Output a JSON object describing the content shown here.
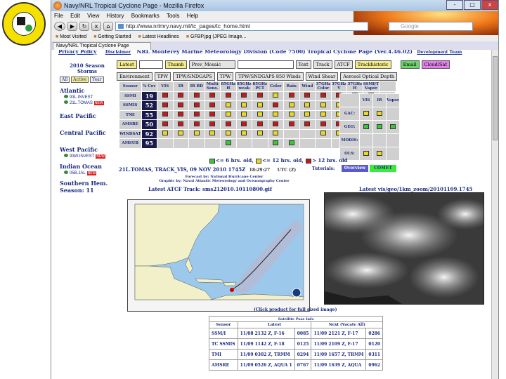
{
  "browser": {
    "window_title": "Navy/NRL Tropical Cyclone Page - Mozilla Firefox",
    "window_buttons": [
      "-",
      "□",
      "x"
    ],
    "menu": [
      "File",
      "Edit",
      "View",
      "History",
      "Bookmarks",
      "Tools",
      "Help"
    ],
    "nav_buttons": {
      "back": "◀",
      "forward": "▶",
      "reload": "↻",
      "stop": "x",
      "home": "⌂"
    },
    "url": "http://www.nrlmry.navy.mil/tc_pages/tc_home.html",
    "search_placeholder": "Google",
    "bookmarks": [
      "Most Visited",
      "Getting Started",
      "Latest Headlines",
      "GFBP.jpg (JPEG Image..."
    ],
    "tab_title": "Navy/NRL Tropical Cyclone Page"
  },
  "page": {
    "header": {
      "privacy": "Privacy Policy",
      "disclaimer": "Disclaimer",
      "title": "NRL Monterey Marine Meteorology Division (Code 7500) Tropical Cyclone Page (Ver.4.46.02)",
      "dev_team": "Development Team"
    },
    "top_buttons_row1": [
      "Latest",
      "",
      "Thumb",
      "Prev_Mosaic",
      "",
      "Text",
      "Track",
      "ATCF",
      "Trackhistoric",
      "Email",
      "Cloud/Sat"
    ],
    "top_buttons_row2": [
      "Environment",
      "TPW",
      "TPW/SNDGAPS",
      "TPW",
      "TPW/SNDGAPS 850 Winds",
      "Wind Shear",
      "Aerosol Optical Depth"
    ],
    "left": {
      "season_header": "2010 Season Storms",
      "modes": [
        "All",
        "Active",
        "Year"
      ],
      "basins": [
        {
          "name": "Atlantic",
          "storms": [
            "93L.INVEST",
            "21L.TOMAS"
          ]
        },
        {
          "name": "East Pacific",
          "storms": []
        },
        {
          "name": "Central Pacific",
          "storms": []
        },
        {
          "name": "West Pacific",
          "storms": [
            "93W.INVEST"
          ]
        },
        {
          "name": "Indian Ocean",
          "storms": [
            "05B.JAL"
          ]
        }
      ],
      "southern": "Southern Hem. Season: 11",
      "new_tag": "NEW"
    },
    "grid": {
      "columns": [
        "Sensor",
        "% Cov",
        "VIS",
        "IR",
        "IR BD",
        "Multi Sens.",
        "85GHz H",
        "85GHz weak",
        "85GHz PCT",
        "Color",
        "Rain",
        "Wind",
        "37GHz Color",
        "37GHz V",
        "37GHz H",
        "SSMI/T Vapor"
      ],
      "rows": [
        {
          "sensor": "SSMI",
          "cov": "19",
          "cells": [
            "r",
            "r",
            "r",
            "r",
            "r",
            "r",
            "r",
            "yy",
            "r",
            "r",
            "r",
            "r",
            "r",
            "r",
            ""
          ]
        },
        {
          "sensor": "SSMIS",
          "cov": "52",
          "cells": [
            "r",
            "r",
            "r",
            "r",
            "yy",
            "yy",
            "yy",
            "r",
            "yy",
            "yy",
            "yy",
            "yy",
            "yy",
            "yy",
            ""
          ]
        },
        {
          "sensor": "TMI",
          "cov": "55",
          "cells": [
            "r",
            "r",
            "r",
            "r",
            "yy",
            "yy",
            "yy",
            "yy",
            "yy",
            "yy",
            "yy",
            "yy",
            "yy",
            "yy",
            ""
          ]
        },
        {
          "sensor": "AMSRE",
          "cov": "50",
          "cells": [
            "r",
            "r",
            "r",
            "r",
            "r",
            "r",
            "r",
            "r",
            "r",
            "r",
            "r",
            "r",
            "r",
            "r",
            ""
          ]
        },
        {
          "sensor": "WINDSAT",
          "cov": "92",
          "cells": [
            "yy",
            "yy",
            "yy",
            "yy",
            "yy",
            "yy",
            "yy",
            "yy",
            "",
            "",
            "yy",
            "yy",
            "yy",
            "yy",
            ""
          ]
        },
        {
          "sensor": "AMSUB",
          "cov": "95",
          "cells": [
            "",
            "",
            "",
            "",
            "gg",
            "",
            "",
            "gg",
            "gg",
            "",
            "",
            "",
            "",
            "",
            ""
          ]
        }
      ]
    },
    "grid_right": {
      "columns": [
        "",
        "VIS",
        "IR",
        "Vapor"
      ],
      "rows": [
        {
          "label": "GAC:",
          "cells": [
            "yy",
            "yy",
            ""
          ]
        },
        {
          "label": "GEO:",
          "cells": [
            "gg",
            "gg",
            "gg"
          ]
        },
        {
          "label": "MODIS:",
          "cells": [
            "",
            "",
            ""
          ]
        },
        {
          "label": "OLS:",
          "cells": [
            "yy",
            "yy",
            ""
          ]
        }
      ]
    },
    "legend": {
      "l1": "<= 6 hrs. old,",
      "l2": "<= 12 hrs. old,",
      "l3": "> 12 hrs. old"
    },
    "info": {
      "storm": "21L.TOMAS, TRACK_VIS, 09 NOV 2010 1745Z",
      "time": "18:29:27",
      "utc": "UTC (Z)",
      "tutorials": "Tutorials:",
      "overview": "Overview",
      "comet": "COMET"
    },
    "credit": {
      "line1": "Forecast by: National Hurricane Center",
      "line2": "Graphic by: Naval Atlantic Meteorology and Oceanography Center"
    },
    "map_caption": "Latest ATCF Track: sms212010.10110800.gif",
    "sat_caption": "Latest vis/geo/1km_zoom/20101109.1745",
    "click_caption": "(Click product for full sized image)",
    "satellite_table": {
      "title": "Satellite Pass Info",
      "headers": [
        "Sensor",
        "Latest",
        "Next (Vacate All)"
      ],
      "rows": [
        {
          "sensor": "SSM/I",
          "latest": "11/08 2132 Z, F-16",
          "n1": "0085",
          "next": "11/09 2121 Z, F-17",
          "n2": "0286"
        },
        {
          "sensor": "TC SSMIS",
          "latest": "11/09 1142 Z, F-18",
          "n1": "0125",
          "next": "11/09 2109 Z, F-17",
          "n2": "0120"
        },
        {
          "sensor": "TMI",
          "latest": "11/09 0302 Z, TRMM",
          "n1": "0294",
          "next": "11/09 1657 Z, TRMM",
          "n2": "0311"
        },
        {
          "sensor": "AMSRE",
          "latest": "11/09 0526 Z, AQUA 1",
          "n1": "0767",
          "next": "11/09 1639 Z, AQUA",
          "n2": "0962"
        }
      ]
    }
  },
  "colors": {
    "red": "#c81818",
    "yellow": "#e8d820",
    "green": "#38c838",
    "header_blue": "#1a3090"
  }
}
